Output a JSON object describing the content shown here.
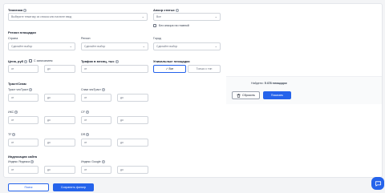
{
  "topic": {
    "label": "Тематика",
    "placeholder": "Выберите тематику из списка или начните ввод"
  },
  "anchor": {
    "label": "Анкор статьи",
    "value": "Все",
    "checkbox_label": "Без анкора на главной"
  },
  "region": {
    "label": "Регион площадки",
    "country_label": "Страна",
    "country_placeholder": "Сделайте выбор",
    "region_label": "Регион",
    "region_placeholder": "Сделайте выбор",
    "city_label": "Город",
    "city_placeholder": "Сделайте выбор"
  },
  "price": {
    "label": "Цена, руб",
    "checkbox_label": "С записанием",
    "from": "от",
    "to": "до"
  },
  "traffic": {
    "label": "Трафик в месяц, тыс",
    "from": "от",
    "to": "до"
  },
  "unique": {
    "label": "Уникальные площадки",
    "option_all": "✓ Все",
    "option_new": "Только с тип"
  },
  "trust": {
    "label": "Траст/Спам",
    "trust_label": "Траст чекТраст",
    "spam_label": "Спам чекТраст",
    "ikc_label": "ИКС",
    "cf_label": "CF",
    "tf_label": "TF",
    "dr_label": "DR",
    "from": "от",
    "to": "до"
  },
  "indexing": {
    "label": "Индексация сайта",
    "yandex_label": "Индекс Яндекса",
    "google_label": "Индекс Google",
    "from": "от",
    "to": "до"
  },
  "results": {
    "found_prefix": "Найдено:",
    "found_value": "5 478 площадок",
    "reset_label": "Сбросить",
    "show_label": "Показать"
  },
  "footer": {
    "search_label": "Поиск",
    "save_label": "Сохранить фильтр"
  },
  "colors": {
    "accent": "#2563eb",
    "border": "#d1d5db"
  },
  "icons": {
    "help": "help-icon",
    "trash": "trash-icon",
    "chat": "chat-icon",
    "chevron": "chevron-down-icon"
  }
}
